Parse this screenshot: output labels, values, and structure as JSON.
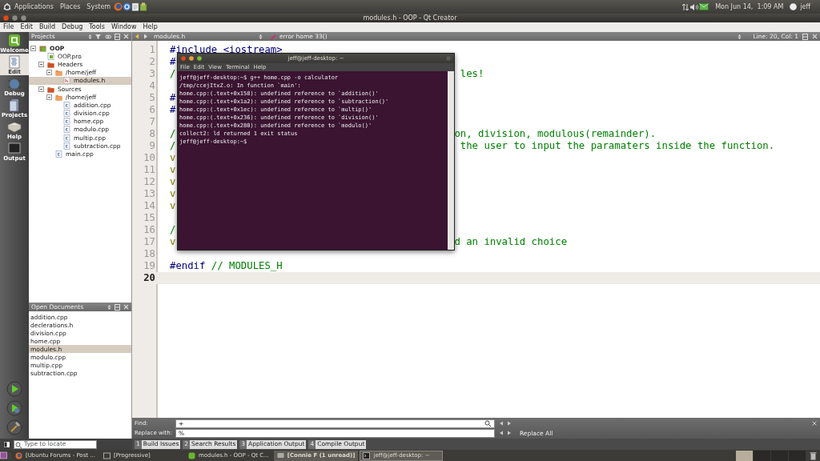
{
  "top_panel": {
    "menus": [
      "Applications",
      "Places",
      "System"
    ],
    "clock": "Mon Jun 14,  1:09 AM",
    "user": "jeff"
  },
  "window": {
    "title": "modules.h - OOP - Qt Creator"
  },
  "menu_bar": [
    "File",
    "Edit",
    "Build",
    "Debug",
    "Tools",
    "Window",
    "Help"
  ],
  "mode_bar": [
    {
      "label": "Welcome",
      "kind": "welcome",
      "selected": false
    },
    {
      "label": "Edit",
      "kind": "edit",
      "selected": true
    },
    {
      "label": "Debug",
      "kind": "debug",
      "selected": false
    },
    {
      "label": "Projects",
      "kind": "projects",
      "selected": false
    },
    {
      "label": "Help",
      "kind": "help",
      "selected": false
    },
    {
      "label": "Output",
      "kind": "output",
      "selected": false
    }
  ],
  "projects_pane": {
    "title": "Projects",
    "tree": [
      {
        "label": "OOP",
        "kind": "project",
        "expanded": true,
        "selected": false,
        "children": [
          {
            "label": "OOP.pro",
            "kind": "pro",
            "selected": false
          },
          {
            "label": "Headers",
            "kind": "folder",
            "expanded": true,
            "selected": false,
            "children": [
              {
                "label": "/home/jeff",
                "kind": "dir",
                "expanded": true,
                "selected": false,
                "children": [
                  {
                    "label": "modules.h",
                    "kind": "header",
                    "selected": true
                  }
                ]
              }
            ]
          },
          {
            "label": "Sources",
            "kind": "folder",
            "expanded": true,
            "selected": false,
            "children": [
              {
                "label": "/home/jeff",
                "kind": "dir",
                "expanded": true,
                "selected": false,
                "children": [
                  {
                    "label": "addition.cpp",
                    "kind": "source",
                    "selected": false
                  },
                  {
                    "label": "division.cpp",
                    "kind": "source",
                    "selected": false
                  },
                  {
                    "label": "home.cpp",
                    "kind": "source",
                    "selected": false
                  },
                  {
                    "label": "modulo.cpp",
                    "kind": "source",
                    "selected": false
                  },
                  {
                    "label": "multip.cpp",
                    "kind": "source",
                    "selected": false
                  },
                  {
                    "label": "subtraction.cpp",
                    "kind": "source",
                    "selected": false
                  }
                ]
              },
              {
                "label": "main.cpp",
                "kind": "source",
                "selected": false
              }
            ]
          }
        ]
      }
    ]
  },
  "open_documents": {
    "title": "Open Documents",
    "items": [
      {
        "label": "addition.cpp",
        "selected": false
      },
      {
        "label": "declerations.h",
        "selected": false
      },
      {
        "label": "division.cpp",
        "selected": false
      },
      {
        "label": "home.cpp",
        "selected": false
      },
      {
        "label": "modules.h",
        "selected": true
      },
      {
        "label": "modulo.cpp",
        "selected": false
      },
      {
        "label": "multip.cpp",
        "selected": false
      },
      {
        "label": "subtraction.cpp",
        "selected": false
      }
    ]
  },
  "locator": {
    "placeholder": "Type to locate"
  },
  "editor_toolbar": {
    "file": "modules.h",
    "symbol": "error home 33()",
    "position": "Line: 20, Col: 1"
  },
  "code_lines": [
    {
      "number": "1",
      "current": false,
      "tokens": [
        {
          "text": "#include <iostream>",
          "kind": "preprocessor"
        }
      ]
    },
    {
      "number": "2",
      "current": false,
      "tokens": [
        {
          "text": "#",
          "kind": "preprocessor"
        }
      ]
    },
    {
      "number": "3",
      "current": false,
      "tokens": [
        {
          "text": "/                                                les!",
          "kind": "comment"
        }
      ]
    },
    {
      "number": "4",
      "current": false
    },
    {
      "number": "5",
      "current": false,
      "tokens": [
        {
          "text": "#",
          "kind": "preprocessor"
        }
      ]
    },
    {
      "number": "6",
      "current": false,
      "tokens": [
        {
          "text": "#",
          "kind": "preprocessor"
        }
      ]
    },
    {
      "number": "7",
      "current": false
    },
    {
      "number": "8",
      "current": false,
      "tokens": [
        {
          "text": "/                                               on, division, modulous(remainder).",
          "kind": "comment"
        }
      ]
    },
    {
      "number": "9",
      "current": false,
      "tokens": [
        {
          "text": "/                                                the user to input the paramaters inside the function.",
          "kind": "comment"
        }
      ]
    },
    {
      "number": "10",
      "current": false,
      "tokens": [
        {
          "text": "v",
          "kind": "keyword"
        }
      ]
    },
    {
      "number": "11",
      "current": false,
      "tokens": [
        {
          "text": "v",
          "kind": "keyword"
        }
      ]
    },
    {
      "number": "12",
      "current": false,
      "tokens": [
        {
          "text": "v",
          "kind": "keyword"
        }
      ]
    },
    {
      "number": "13",
      "current": false,
      "tokens": [
        {
          "text": "v",
          "kind": "keyword"
        }
      ]
    },
    {
      "number": "14",
      "current": false,
      "tokens": [
        {
          "text": "v",
          "kind": "keyword"
        }
      ]
    },
    {
      "number": "15",
      "current": false
    },
    {
      "number": "16",
      "current": false,
      "tokens": [
        {
          "text": "/",
          "kind": "comment"
        }
      ]
    },
    {
      "number": "17",
      "current": false,
      "tokens": [
        {
          "text": "v",
          "kind": "keyword"
        },
        {
          "text": "                                               d an invalid choice",
          "kind": "comment"
        }
      ]
    },
    {
      "number": "18",
      "current": false
    },
    {
      "number": "19",
      "current": false,
      "tokens": [
        {
          "text": "#endif ",
          "kind": "preprocessor"
        },
        {
          "text": "// MODULES_H",
          "kind": "comment"
        }
      ]
    },
    {
      "number": "20",
      "current": true
    }
  ],
  "terminal": {
    "title": "jeff@jeff-desktop: ~",
    "menus": [
      "File",
      "Edit",
      "View",
      "Terminal",
      "Help"
    ],
    "lines": [
      "jeff@jeff-desktop:~$ g++ home.cpp -o calculator",
      "/tmp/ccejItxZ.o: In function `main':",
      "home.cpp:(.text+0x158): undefined reference to `addition()'",
      "home.cpp:(.text+0x1a2): undefined reference to `subtraction()'",
      "home.cpp:(.text+0x1ec): undefined reference to `multip()'",
      "home.cpp:(.text+0x236): undefined reference to `division()'",
      "home.cpp:(.text+0x280): undefined reference to `modulo()'",
      "collect2: ld returned 1 exit status",
      "jeff@jeff-desktop:~$"
    ]
  },
  "find_bar": {
    "find_label": "Find:",
    "find_value": "+",
    "replace_label": "Replace with:",
    "replace_value": "%",
    "replace_all": "Replace All"
  },
  "output_tabs": [
    {
      "number": "1",
      "label": "Build Issues"
    },
    {
      "number": "2",
      "label": "Search Results"
    },
    {
      "number": "3",
      "label": "Application Output"
    },
    {
      "number": "4",
      "label": "Compile Output"
    }
  ],
  "taskbar": {
    "items": [
      {
        "label": "[Ubuntu Forums - Post ...",
        "kind": "browser",
        "selected": false,
        "urgent": false
      },
      {
        "label": "[Progressive]",
        "kind": "app",
        "selected": false,
        "urgent": false
      },
      {
        "label": "modules.h - OOP - Qt C...",
        "kind": "qt",
        "selected": false,
        "urgent": false
      },
      {
        "label": "[Connie F (1 unread)]",
        "kind": "chat",
        "selected": false,
        "urgent": true
      },
      {
        "label": "jeff@jeff-desktop: ~",
        "kind": "terminal",
        "selected": true,
        "urgent": false
      }
    ],
    "workspaces": [
      {
        "selected": true
      },
      {
        "selected": false
      },
      {
        "selected": false
      },
      {
        "selected": false
      }
    ]
  }
}
